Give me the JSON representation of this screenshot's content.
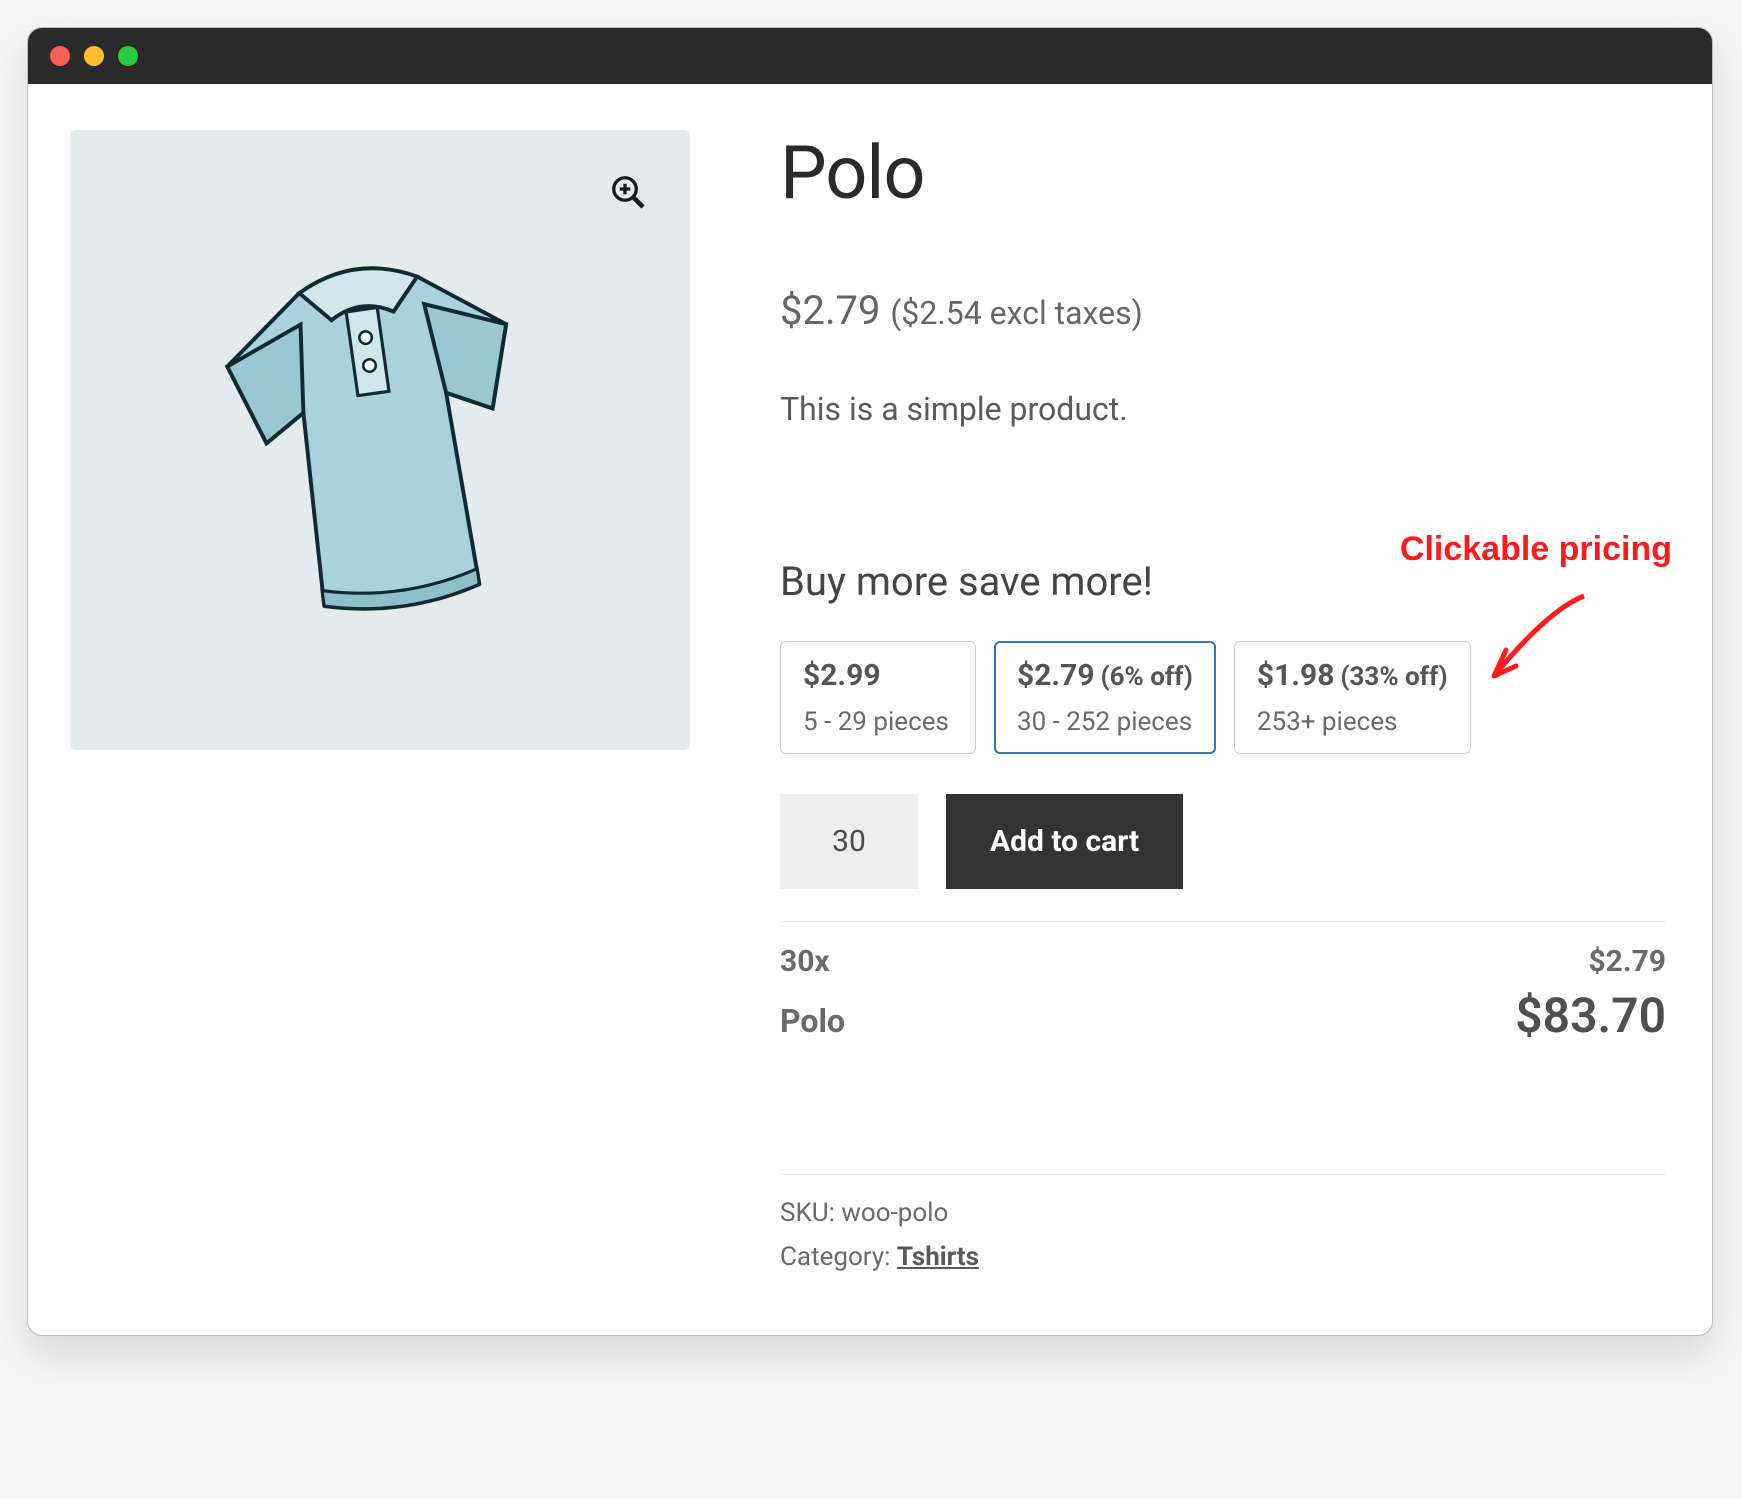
{
  "product": {
    "title": "Polo",
    "price_incl": "$2.79",
    "price_excl": "($2.54 excl taxes)",
    "description": "This is a simple product.",
    "tier_heading": "Buy more save more!"
  },
  "tiers": [
    {
      "price": "$2.99",
      "off": "",
      "range": "5 - 29 pieces",
      "selected": false
    },
    {
      "price": "$2.79",
      "off": "(6% off)",
      "range": "30 - 252 pieces",
      "selected": true
    },
    {
      "price": "$1.98",
      "off": "(33% off)",
      "range": "253+ pieces",
      "selected": false
    }
  ],
  "cart": {
    "quantity": "30",
    "add_label": "Add to cart"
  },
  "summary": {
    "qty_line": "30x",
    "qty_price": "$2.79",
    "name": "Polo",
    "total": "$83.70"
  },
  "meta": {
    "sku_label": "SKU: ",
    "sku_value": "woo-polo",
    "cat_label": "Category: ",
    "cat_value": "Tshirts"
  },
  "annotation": {
    "text": "Clickable pricing"
  }
}
